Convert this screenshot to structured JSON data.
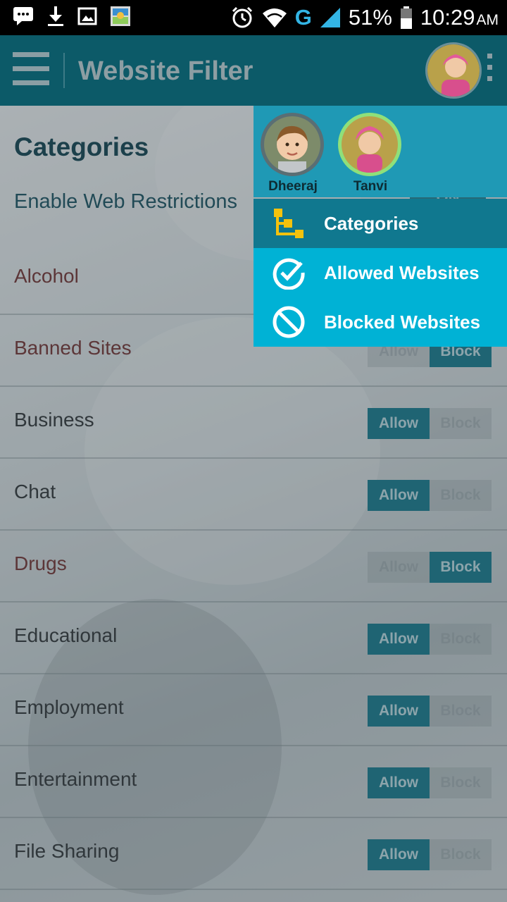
{
  "status_bar": {
    "battery": "51%",
    "network": "G",
    "time": "10:29",
    "ampm": "AM"
  },
  "app_bar": {
    "title": "Website Filter"
  },
  "page": {
    "heading": "Categories",
    "enable_label": "Enable Web Restrictions",
    "enable_toggle": "ON"
  },
  "categories": [
    {
      "label": "Alcohol",
      "state": "Block"
    },
    {
      "label": "Banned Sites",
      "state": "Block"
    },
    {
      "label": "Business",
      "state": "Allow"
    },
    {
      "label": "Chat",
      "state": "Allow"
    },
    {
      "label": "Drugs",
      "state": "Block"
    },
    {
      "label": "Educational",
      "state": "Allow"
    },
    {
      "label": "Employment",
      "state": "Allow"
    },
    {
      "label": "Entertainment",
      "state": "Allow"
    },
    {
      "label": "File Sharing",
      "state": "Allow"
    }
  ],
  "toggle_labels": {
    "allow": "Allow",
    "block": "Block"
  },
  "menu": {
    "profiles": [
      {
        "name": "Dheeraj",
        "ring_color": "#5a6e74"
      },
      {
        "name": "Tanvi",
        "ring_color": "#8fe07a"
      }
    ],
    "items": [
      {
        "label": "Categories",
        "icon": "tree-icon",
        "active": true
      },
      {
        "label": "Allowed Websites",
        "icon": "check-circle-icon",
        "active": false
      },
      {
        "label": "Blocked Websites",
        "icon": "block-icon",
        "active": false
      }
    ]
  },
  "colors": {
    "appbar": "#0c5a68",
    "menu_active": "#10788f",
    "menu_normal": "#00b2d5",
    "toggle_on": "#107689"
  }
}
